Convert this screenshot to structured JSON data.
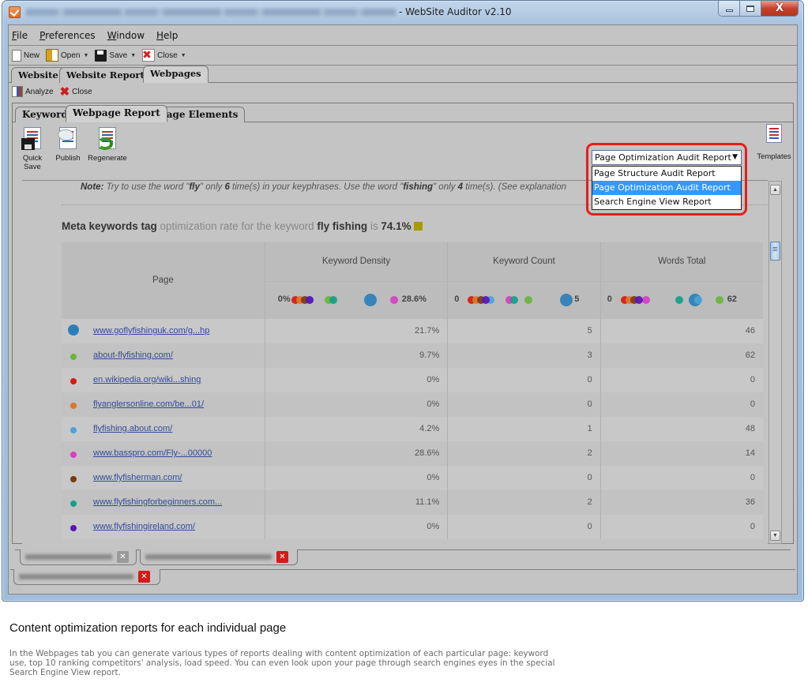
{
  "window": {
    "title_suffix": "- WebSite Auditor v2.10",
    "controls": {
      "minimize": "minimize",
      "maximize": "maximize",
      "close": "X"
    }
  },
  "menubar": [
    {
      "label": "File",
      "mnemonic": "F",
      "rest": "ile"
    },
    {
      "label": "Preferences",
      "mnemonic": "P",
      "rest": "references"
    },
    {
      "label": "Window",
      "mnemonic": "W",
      "rest": "indow"
    },
    {
      "label": "Help",
      "mnemonic": "H",
      "rest": "elp"
    }
  ],
  "toolbar": {
    "new_label": "New",
    "open_label": "Open",
    "save_label": "Save",
    "close_label": "Close"
  },
  "main_tabs": [
    {
      "label": "Website",
      "active": false
    },
    {
      "label": "Website Report",
      "active": false
    },
    {
      "label": "Webpages",
      "active": true
    }
  ],
  "subbar": {
    "analyze_label": "Analyze",
    "close_label": "Close"
  },
  "inner_tabs": [
    {
      "label": "Keywords",
      "active": false
    },
    {
      "label": "Webpage Report",
      "active": true
    },
    {
      "label": "Page Elements",
      "active": false
    }
  ],
  "report_toolbar": {
    "quick_save": "Quick Save",
    "publish": "Publish",
    "regenerate": "Regenerate",
    "templates": "Templates"
  },
  "report_dropdown": {
    "selected": "Page Optimization Audit Report",
    "options": [
      {
        "label": "Page Structure Audit Report",
        "selected": false
      },
      {
        "label": "Page Optimization Audit Report",
        "selected": true
      },
      {
        "label": "Search Engine View Report",
        "selected": false
      }
    ]
  },
  "report": {
    "note": {
      "prefix": "Note:",
      "t1": " Try to use the word \"",
      "w1": "fly",
      "t2": "\" only ",
      "n1": "6",
      "t3": " time(s) in your keyphrases.  Use the word \"",
      "w2": "fishing",
      "t4": "\" only ",
      "n2": "4",
      "t5": " time(s). (See explanation"
    },
    "meta": {
      "element": "Meta keywords tag",
      "t1": " optimization rate for the keyword ",
      "keyword": "fly fishing",
      "t2": " is ",
      "rate": "74.1%",
      "rate_color": "#a89b00"
    },
    "columns": {
      "page": "Page",
      "density": "Keyword Density",
      "count": "Keyword Count",
      "words": "Words Total"
    },
    "scales": {
      "density": {
        "min_label": "0%",
        "max_label": "28.6%",
        "min": 0,
        "max": 28.6
      },
      "count": {
        "min_label": "0",
        "max_label": "5",
        "min": 0,
        "max": 5
      },
      "words": {
        "min_label": "0",
        "max_label": "62",
        "min": 0,
        "max": 62
      }
    },
    "rows": [
      {
        "url": "www.goflyfishinguk.com/g...hp",
        "color": "#2a7fb8",
        "highlight": true,
        "density": "21.7%",
        "density_v": 21.7,
        "count": "5",
        "count_v": 5,
        "words": "46",
        "words_v": 46
      },
      {
        "url": "about-flyfishing.com/",
        "color": "#6ab53a",
        "density": "9.7%",
        "density_v": 9.7,
        "count": "3",
        "count_v": 3,
        "words": "62",
        "words_v": 62
      },
      {
        "url": "en.wikipedia.org/wiki...shing",
        "color": "#d81a0e",
        "density": "0%",
        "density_v": 0,
        "count": "0",
        "count_v": 0,
        "words": "0",
        "words_v": 0
      },
      {
        "url": "flyanglersonline.com/be...01/",
        "color": "#d8772e",
        "density": "0%",
        "density_v": 0,
        "count": "0",
        "count_v": 0,
        "words": "0",
        "words_v": 0
      },
      {
        "url": "flyfishing.about.com/",
        "color": "#4aa3d8",
        "density": "4.2%",
        "density_v": 4.2,
        "count": "1",
        "count_v": 1,
        "words": "48",
        "words_v": 48
      },
      {
        "url": "www.basspro.com/Fly-...00000",
        "color": "#d63ec0",
        "density": "28.6%",
        "density_v": 28.6,
        "count": "2",
        "count_v": 2,
        "words": "14",
        "words_v": 14
      },
      {
        "url": "www.flyfisherman.com/",
        "color": "#7a3a12",
        "density": "0%",
        "density_v": 0,
        "count": "0",
        "count_v": 0,
        "words": "0",
        "words_v": 0
      },
      {
        "url": "www.flyfishingforbeginners.com...",
        "color": "#14a088",
        "density": "11.1%",
        "density_v": 11.1,
        "count": "2",
        "count_v": 2,
        "words": "36",
        "words_v": 36
      },
      {
        "url": "www.flyfishingireland.com/",
        "color": "#5a14b8",
        "density": "0%",
        "density_v": 0,
        "count": "0",
        "count_v": 0,
        "words": "0",
        "words_v": 0
      }
    ]
  },
  "caption": {
    "title": "Content optimization reports for each individual page",
    "body": "In the Webpages tab you can generate various types of reports dealing with content optimization of each particular page: keyword use, top 10 ranking competitors' analysis, load speed. You can even look upon your page through search engines eyes in the special Search Engine View report."
  }
}
